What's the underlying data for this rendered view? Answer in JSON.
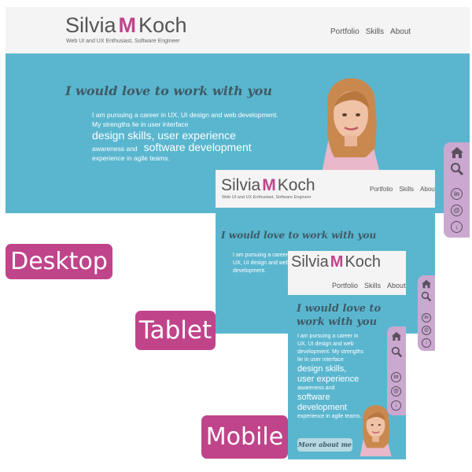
{
  "brand": {
    "first": "Silvia",
    "middle": "M",
    "last": "Koch",
    "tagline": "Web UI and UX Enthusiast, Software Engineer"
  },
  "nav": [
    "Portfolio",
    "Skills",
    "About"
  ],
  "hero": {
    "headline": "I would love to work with you",
    "line1": "I am pursuing a career in UX, UI design and web development.",
    "line2": "My strengths lie in user interface",
    "big1": "design skills, user experience",
    "line3": "awareness and",
    "big2": "software development",
    "line4": "experience in agile teams."
  },
  "mobile": {
    "headline1": "I would love to",
    "headline2": "work with you",
    "p1": "I am pursuing a career in",
    "p2": "UX, UI design and web",
    "p3": "development. My strengths",
    "p4": "lie in user interface",
    "b1": "design skills,",
    "b2": "user experience",
    "p5": "awareness and",
    "b3": "software",
    "b4": "development",
    "p6": "experience in agile teams."
  },
  "button": "More about me",
  "labels": {
    "desktop": "Desktop",
    "tablet": "Tablet",
    "mobile": "Mobile"
  },
  "icons": [
    "home-icon",
    "search-icon",
    "linkedin-icon",
    "at-sign-icon",
    "download-icon"
  ],
  "colors": {
    "hero": "#5ab6cf",
    "accent": "#c0448a",
    "sidebar": "#cba8d0",
    "header": "#f4f4f4"
  }
}
